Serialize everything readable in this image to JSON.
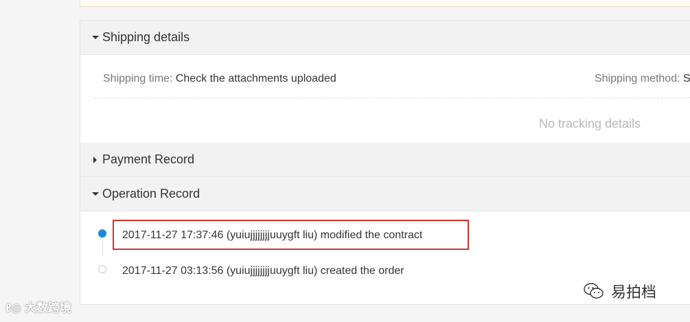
{
  "shipping": {
    "title": "Shipping details",
    "time_label": "Shipping time:",
    "time_value": "Check the attachments uploaded",
    "method_label": "Shipping method:",
    "method_value": "S",
    "no_tracking": "No tracking details"
  },
  "payment": {
    "title": "Payment Record"
  },
  "operation": {
    "title": "Operation Record",
    "records": [
      {
        "text": "2017-11-27 17:37:46 (yuiujjjjjjjjuuygft liu) modified the contract",
        "highlighted": true
      },
      {
        "text": "2017-11-27 03:13:56 (yuiujjjjjjjjuuygft liu) created the order",
        "highlighted": false
      }
    ]
  },
  "watermarks": {
    "left": "大数跨境",
    "left_logo": "ℓ◎",
    "right": "易拍档",
    "right_icon": "wechat-icon"
  },
  "colors": {
    "highlight_border": "#d42f2f",
    "timeline_active": "#1e88d6",
    "header_bg": "#f2f2f2"
  }
}
